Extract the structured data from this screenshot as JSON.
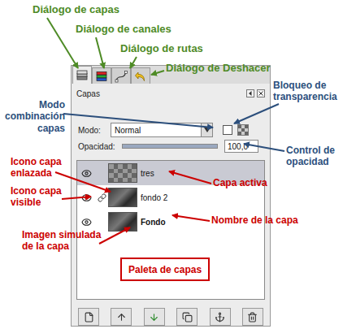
{
  "annotations": [
    {
      "lines": [
        "Diálogo de capas"
      ],
      "color": "#4e8b26"
    },
    {
      "lines": [
        "Diálogo de canales"
      ],
      "color": "#4e8b26"
    },
    {
      "lines": [
        "Diálogo de rutas"
      ],
      "color": "#4e8b26"
    },
    {
      "lines": [
        "Diálogo de Deshacer"
      ],
      "color": "#4e8b26"
    },
    {
      "lines": [
        "Bloqueo de",
        "transparencia"
      ],
      "color": "#2c4f7c"
    },
    {
      "lines": [
        "Modo",
        "combinación",
        "capas"
      ],
      "color": "#2c4f7c"
    },
    {
      "lines": [
        "Control de",
        "opacidad"
      ],
      "color": "#2c4f7c"
    },
    {
      "lines": [
        "Icono capa",
        "enlazada"
      ],
      "color": "#cc0000"
    },
    {
      "lines": [
        "Icono capa",
        "visible"
      ],
      "color": "#cc0000"
    },
    {
      "lines": [
        "Capa activa"
      ],
      "color": "#cc0000"
    },
    {
      "lines": [
        "Nombre de la capa"
      ],
      "color": "#cc0000"
    },
    {
      "lines": [
        "Imagen simulada",
        "de la capa"
      ],
      "color": "#cc0000"
    }
  ],
  "caption": {
    "text": "Paleta de capas",
    "color": "#cc0000"
  },
  "panel": {
    "tabs": [
      {
        "selected": true
      },
      {
        "selected": false
      },
      {
        "selected": false
      },
      {
        "selected": false
      }
    ],
    "title": "Capas",
    "mode_label": "Modo:",
    "mode": "Normal",
    "lock_alpha": false,
    "opacity_label": "Opacidad:",
    "opacity": "100,0",
    "opacity_level": 1,
    "layers": [
      {
        "name": "tres",
        "visible": true,
        "linked": false,
        "selected": true,
        "kind": "transparent"
      },
      {
        "name": "fondo 2",
        "visible": true,
        "linked": true,
        "selected": false,
        "kind": "normal"
      },
      {
        "name": "Fondo",
        "visible": true,
        "linked": false,
        "selected": false,
        "kind": "background"
      }
    ]
  }
}
